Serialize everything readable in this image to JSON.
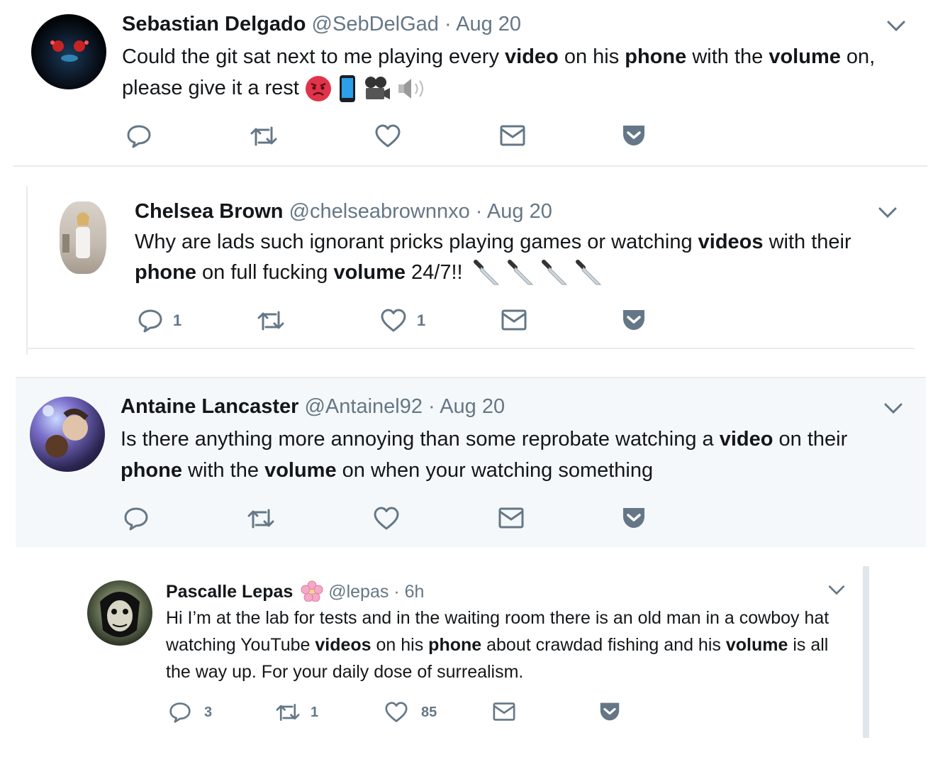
{
  "tweets": [
    {
      "name": "Sebastian Delgado",
      "handle": "@SebDelGad",
      "sep": "·",
      "time": "Aug 20",
      "text": [
        {
          "t": "Could the git sat next to me playing every ",
          "b": false
        },
        {
          "t": "video",
          "b": true
        },
        {
          "t": " on his ",
          "b": false
        },
        {
          "t": "phone",
          "b": true
        },
        {
          "t": " with the ",
          "b": false
        },
        {
          "t": "volume",
          "b": true
        },
        {
          "t": " on, please give it a rest",
          "b": false
        }
      ],
      "emoji": [
        "angry-face",
        "mobile-phone",
        "movie-camera",
        "speaker"
      ],
      "counts": {
        "reply": "",
        "retweet": "",
        "like": ""
      }
    },
    {
      "name": "Chelsea Brown",
      "handle": "@chelseabrownnxo",
      "sep": "·",
      "time": "Aug 20",
      "text": [
        {
          "t": "Why are lads such ignorant pricks playing games or watching ",
          "b": false
        },
        {
          "t": "videos",
          "b": true
        },
        {
          "t": " with their ",
          "b": false
        },
        {
          "t": "phone",
          "b": true
        },
        {
          "t": " on full fucking ",
          "b": false
        },
        {
          "t": "volume",
          "b": true
        },
        {
          "t": " 24/7!!",
          "b": false
        }
      ],
      "emoji": [
        "knife",
        "knife",
        "knife",
        "knife"
      ],
      "counts": {
        "reply": "1",
        "retweet": "",
        "like": "1"
      }
    },
    {
      "name": "Antaine Lancaster",
      "handle": "@Antainel92",
      "sep": "·",
      "time": "Aug 20",
      "text": [
        {
          "t": "Is there anything more annoying  than some reprobate watching a ",
          "b": false
        },
        {
          "t": "video",
          "b": true
        },
        {
          "t": " on their ",
          "b": false
        },
        {
          "t": "phone",
          "b": true
        },
        {
          "t": " with the ",
          "b": false
        },
        {
          "t": "volume",
          "b": true
        },
        {
          "t": " on when your watching something",
          "b": false
        }
      ],
      "emoji": [],
      "counts": {
        "reply": "",
        "retweet": "",
        "like": ""
      }
    },
    {
      "name": "Pascalle Lepas",
      "name_emoji": "cherry-blossom",
      "handle": "@lepas",
      "sep": "·",
      "time": "6h",
      "text": [
        {
          "t": "Hi I’m at the lab for tests and in the waiting room there is an old man in a cowboy hat watching YouTube ",
          "b": false
        },
        {
          "t": "videos",
          "b": true
        },
        {
          "t": " on his ",
          "b": false
        },
        {
          "t": "phone",
          "b": true
        },
        {
          "t": " about crawdad fishing and his ",
          "b": false
        },
        {
          "t": "volume",
          "b": true
        },
        {
          "t": " is all the way up. For your daily dose of surrealism.",
          "b": false
        }
      ],
      "emoji": [],
      "counts": {
        "reply": "3",
        "retweet": "1",
        "like": "85"
      }
    }
  ],
  "icons": {
    "reply": "reply-icon",
    "retweet": "retweet-icon",
    "like": "heart-icon",
    "dm": "envelope-icon",
    "pocket": "pocket-icon",
    "caret": "chevron-down-icon"
  },
  "colors": {
    "icon": "#657786",
    "pocket": "#657786",
    "highlight_bg": "#f5f8fa",
    "divider": "#e6ecf0"
  }
}
